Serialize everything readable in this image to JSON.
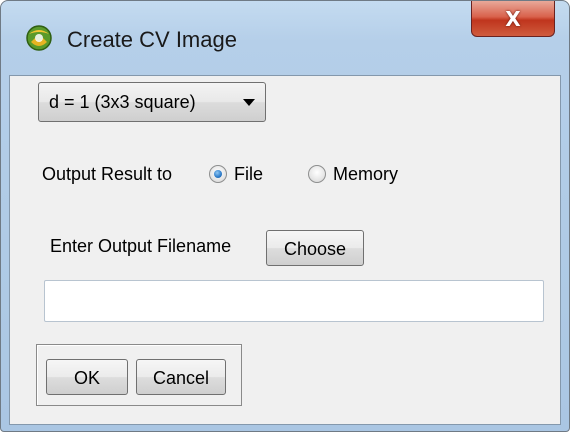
{
  "window": {
    "title": "Create CV Image",
    "close_glyph": "X",
    "app_icon": "app-logo-icon"
  },
  "dropdown": {
    "selected": "d = 1 (3x3 square)",
    "arrow_icon": "chevron-down-icon"
  },
  "output": {
    "label": "Output Result to",
    "options": [
      {
        "label": "File",
        "checked": true
      },
      {
        "label": "Memory",
        "checked": false
      }
    ]
  },
  "filename": {
    "label": "Enter Output Filename",
    "choose_label": "Choose",
    "value": ""
  },
  "actions": {
    "ok_label": "OK",
    "cancel_label": "Cancel"
  },
  "colors": {
    "frame": "#b5cfe9",
    "client": "#f0f0f0",
    "close_button": "#c8462f",
    "radio_selected": "#2c7bc9"
  }
}
